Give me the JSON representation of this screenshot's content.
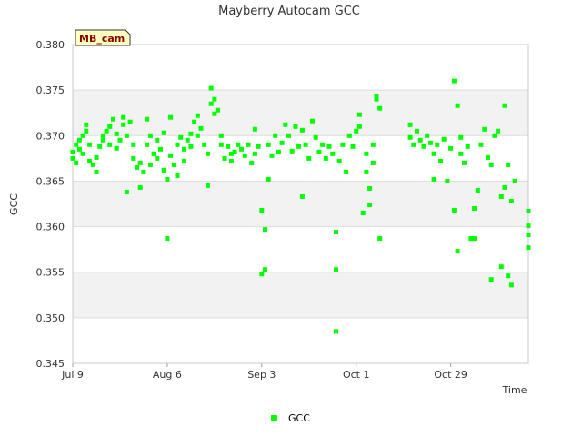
{
  "chart_data": {
    "type": "scatter",
    "title": "Mayberry Autocam GCC",
    "xlabel": "Time",
    "ylabel": "GCC",
    "ylim": [
      0.345,
      0.38
    ],
    "xlim": [
      "2023-07-09",
      "2023-11-21"
    ],
    "y_ticks": [
      "0.345",
      "0.350",
      "0.355",
      "0.360",
      "0.365",
      "0.370",
      "0.375",
      "0.380"
    ],
    "x_ticks": [
      {
        "date": "2023-07-09",
        "label": "Jul 9"
      },
      {
        "date": "2023-08-06",
        "label": "Aug 6"
      },
      {
        "date": "2023-09-03",
        "label": "Sep 3"
      },
      {
        "date": "2023-10-01",
        "label": "Oct 1"
      },
      {
        "date": "2023-10-29",
        "label": "Oct 29"
      }
    ],
    "grid": true,
    "legend_position": "bottom-center",
    "badge": "MB_cam",
    "series": [
      {
        "name": "GCC",
        "color": "#00ff00",
        "points": [
          [
            "2023-07-09",
            0.3675
          ],
          [
            "2023-07-09",
            0.3682
          ],
          [
            "2023-07-10",
            0.369
          ],
          [
            "2023-07-10",
            0.367
          ],
          [
            "2023-07-11",
            0.3685
          ],
          [
            "2023-07-11",
            0.3695
          ],
          [
            "2023-07-12",
            0.37
          ],
          [
            "2023-07-12",
            0.368
          ],
          [
            "2023-07-13",
            0.3705
          ],
          [
            "2023-07-13",
            0.3712
          ],
          [
            "2023-07-14",
            0.369
          ],
          [
            "2023-07-14",
            0.3672
          ],
          [
            "2023-07-15",
            0.3668
          ],
          [
            "2023-07-16",
            0.366
          ],
          [
            "2023-07-16",
            0.3676
          ],
          [
            "2023-07-17",
            0.3688
          ],
          [
            "2023-07-18",
            0.37
          ],
          [
            "2023-07-18",
            0.3695
          ],
          [
            "2023-07-19",
            0.3705
          ],
          [
            "2023-07-20",
            0.369
          ],
          [
            "2023-07-20",
            0.371
          ],
          [
            "2023-07-21",
            0.3718
          ],
          [
            "2023-07-22",
            0.3702
          ],
          [
            "2023-07-22",
            0.3686
          ],
          [
            "2023-07-23",
            0.3695
          ],
          [
            "2023-07-24",
            0.3712
          ],
          [
            "2023-07-24",
            0.372
          ],
          [
            "2023-07-25",
            0.37
          ],
          [
            "2023-07-25",
            0.3638
          ],
          [
            "2023-07-26",
            0.3715
          ],
          [
            "2023-07-27",
            0.369
          ],
          [
            "2023-07-27",
            0.3675
          ],
          [
            "2023-07-28",
            0.3665
          ],
          [
            "2023-07-29",
            0.3643
          ],
          [
            "2023-07-29",
            0.367
          ],
          [
            "2023-07-30",
            0.366
          ],
          [
            "2023-07-31",
            0.369
          ],
          [
            "2023-07-31",
            0.3718
          ],
          [
            "2023-08-01",
            0.37
          ],
          [
            "2023-08-01",
            0.3668
          ],
          [
            "2023-08-02",
            0.368
          ],
          [
            "2023-08-03",
            0.3695
          ],
          [
            "2023-08-03",
            0.3675
          ],
          [
            "2023-08-04",
            0.3685
          ],
          [
            "2023-08-05",
            0.3703
          ],
          [
            "2023-08-05",
            0.3662
          ],
          [
            "2023-08-06",
            0.3652
          ],
          [
            "2023-08-06",
            0.3587
          ],
          [
            "2023-08-07",
            0.372
          ],
          [
            "2023-08-07",
            0.3678
          ],
          [
            "2023-08-08",
            0.3668
          ],
          [
            "2023-08-09",
            0.369
          ],
          [
            "2023-08-09",
            0.3656
          ],
          [
            "2023-08-10",
            0.3698
          ],
          [
            "2023-08-11",
            0.3685
          ],
          [
            "2023-08-11",
            0.3672
          ],
          [
            "2023-08-12",
            0.3695
          ],
          [
            "2023-08-13",
            0.3702
          ],
          [
            "2023-08-13",
            0.3688
          ],
          [
            "2023-08-14",
            0.3715
          ],
          [
            "2023-08-15",
            0.3722
          ],
          [
            "2023-08-15",
            0.37
          ],
          [
            "2023-08-16",
            0.3708
          ],
          [
            "2023-08-17",
            0.369
          ],
          [
            "2023-08-18",
            0.368
          ],
          [
            "2023-08-18",
            0.3645
          ],
          [
            "2023-08-19",
            0.3735
          ],
          [
            "2023-08-19",
            0.3752
          ],
          [
            "2023-08-20",
            0.374
          ],
          [
            "2023-08-20",
            0.3724
          ],
          [
            "2023-08-21",
            0.3728
          ],
          [
            "2023-08-22",
            0.37
          ],
          [
            "2023-08-22",
            0.369
          ],
          [
            "2023-08-23",
            0.3675
          ],
          [
            "2023-08-24",
            0.3688
          ],
          [
            "2023-08-25",
            0.368
          ],
          [
            "2023-08-25",
            0.3672
          ],
          [
            "2023-08-26",
            0.3682
          ],
          [
            "2023-08-27",
            0.369
          ],
          [
            "2023-08-28",
            0.3685
          ],
          [
            "2023-08-29",
            0.3678
          ],
          [
            "2023-08-30",
            0.369
          ],
          [
            "2023-08-31",
            0.367
          ],
          [
            "2023-09-01",
            0.368
          ],
          [
            "2023-09-01",
            0.3707
          ],
          [
            "2023-09-02",
            0.3688
          ],
          [
            "2023-09-03",
            0.3618
          ],
          [
            "2023-09-03",
            0.3548
          ],
          [
            "2023-09-04",
            0.3597
          ],
          [
            "2023-09-04",
            0.3553
          ],
          [
            "2023-09-05",
            0.3652
          ],
          [
            "2023-09-05",
            0.369
          ],
          [
            "2023-09-06",
            0.3678
          ],
          [
            "2023-09-07",
            0.37
          ],
          [
            "2023-09-08",
            0.3682
          ],
          [
            "2023-09-09",
            0.3692
          ],
          [
            "2023-09-10",
            0.3712
          ],
          [
            "2023-09-11",
            0.37
          ],
          [
            "2023-09-12",
            0.3683
          ],
          [
            "2023-09-13",
            0.371
          ],
          [
            "2023-09-14",
            0.3688
          ],
          [
            "2023-09-15",
            0.3633
          ],
          [
            "2023-09-15",
            0.3706
          ],
          [
            "2023-09-16",
            0.369
          ],
          [
            "2023-09-17",
            0.3675
          ],
          [
            "2023-09-18",
            0.3716
          ],
          [
            "2023-09-19",
            0.3698
          ],
          [
            "2023-09-20",
            0.3682
          ],
          [
            "2023-09-21",
            0.369
          ],
          [
            "2023-09-22",
            0.3675
          ],
          [
            "2023-09-23",
            0.3688
          ],
          [
            "2023-09-24",
            0.368
          ],
          [
            "2023-09-25",
            0.3485
          ],
          [
            "2023-09-25",
            0.3594
          ],
          [
            "2023-09-25",
            0.3553
          ],
          [
            "2023-09-26",
            0.3672
          ],
          [
            "2023-09-27",
            0.369
          ],
          [
            "2023-09-28",
            0.366
          ],
          [
            "2023-09-29",
            0.37
          ],
          [
            "2023-09-30",
            0.3688
          ],
          [
            "2023-10-01",
            0.3705
          ],
          [
            "2023-10-02",
            0.3723
          ],
          [
            "2023-10-02",
            0.371
          ],
          [
            "2023-10-03",
            0.3615
          ],
          [
            "2023-10-04",
            0.368
          ],
          [
            "2023-10-04",
            0.366
          ],
          [
            "2023-10-05",
            0.3624
          ],
          [
            "2023-10-05",
            0.3642
          ],
          [
            "2023-10-06",
            0.367
          ],
          [
            "2023-10-06",
            0.369
          ],
          [
            "2023-10-07",
            0.3743
          ],
          [
            "2023-10-07",
            0.374
          ],
          [
            "2023-10-08",
            0.3587
          ],
          [
            "2023-10-08",
            0.373
          ],
          [
            "2023-10-17",
            0.3712
          ],
          [
            "2023-10-17",
            0.3698
          ],
          [
            "2023-10-18",
            0.369
          ],
          [
            "2023-10-19",
            0.3705
          ],
          [
            "2023-10-20",
            0.3695
          ],
          [
            "2023-10-21",
            0.3688
          ],
          [
            "2023-10-22",
            0.37
          ],
          [
            "2023-10-23",
            0.3692
          ],
          [
            "2023-10-24",
            0.368
          ],
          [
            "2023-10-24",
            0.3652
          ],
          [
            "2023-10-25",
            0.369
          ],
          [
            "2023-10-26",
            0.3672
          ],
          [
            "2023-10-27",
            0.3696
          ],
          [
            "2023-10-28",
            0.365
          ],
          [
            "2023-10-29",
            0.3686
          ],
          [
            "2023-10-30",
            0.3618
          ],
          [
            "2023-10-30",
            0.376
          ],
          [
            "2023-10-31",
            0.3733
          ],
          [
            "2023-10-31",
            0.3573
          ],
          [
            "2023-11-01",
            0.3698
          ],
          [
            "2023-11-01",
            0.368
          ],
          [
            "2023-11-02",
            0.367
          ],
          [
            "2023-11-03",
            0.3688
          ],
          [
            "2023-11-04",
            0.3587
          ],
          [
            "2023-11-05",
            0.362
          ],
          [
            "2023-11-05",
            0.3587
          ],
          [
            "2023-11-06",
            0.364
          ],
          [
            "2023-11-07",
            0.369
          ],
          [
            "2023-11-08",
            0.3707
          ],
          [
            "2023-11-09",
            0.3676
          ],
          [
            "2023-11-10",
            0.3668
          ],
          [
            "2023-11-10",
            0.3542
          ],
          [
            "2023-11-11",
            0.37
          ],
          [
            "2023-11-12",
            0.3705
          ],
          [
            "2023-11-13",
            0.3633
          ],
          [
            "2023-11-13",
            0.3556
          ],
          [
            "2023-11-14",
            0.3733
          ],
          [
            "2023-11-14",
            0.3643
          ],
          [
            "2023-11-15",
            0.3668
          ],
          [
            "2023-11-15",
            0.3546
          ],
          [
            "2023-11-16",
            0.3536
          ],
          [
            "2023-11-16",
            0.3628
          ],
          [
            "2023-11-17",
            0.365
          ],
          [
            "2023-11-21",
            0.3617
          ],
          [
            "2023-11-21",
            0.3601
          ],
          [
            "2023-11-21",
            0.3591
          ],
          [
            "2023-11-21",
            0.3577
          ]
        ]
      }
    ]
  }
}
